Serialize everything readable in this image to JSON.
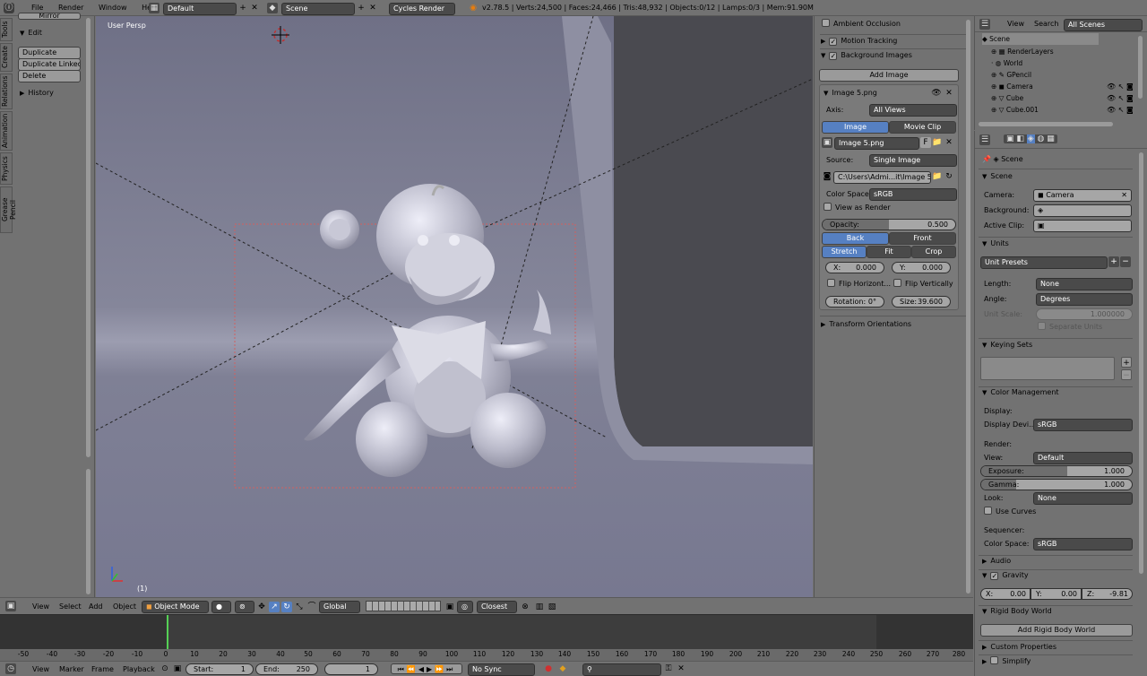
{
  "topbar": {
    "menus": [
      "File",
      "Render",
      "Window",
      "Help"
    ],
    "layout": "Default",
    "scene": "Scene",
    "engine": "Cycles Render",
    "stats": "v2.78.5 | Verts:24,500 | Faces:24,466 | Tris:48,932 | Objects:0/12 | Lamps:0/3 | Mem:91.90M"
  },
  "toolshelf": {
    "tabs": [
      "Tools",
      "Create",
      "Relations",
      "Animation",
      "Physics",
      "Grease Pencil"
    ],
    "top_cut": "Mirror",
    "edit_header": "Edit",
    "buttons": [
      "Duplicate",
      "Duplicate Linked",
      "Delete"
    ],
    "history_header": "History"
  },
  "viewport": {
    "view_label": "User Persp",
    "frame_label": "(1)"
  },
  "npanel": {
    "ambient_occlusion": "Ambient Occlusion",
    "motion_tracking": "Motion Tracking",
    "background_images": "Background Images",
    "add_image": "Add Image",
    "image_name": "Image 5.png",
    "axis_label": "Axis:",
    "axis_value": "All Views",
    "tab_image": "Image",
    "tab_movie": "Movie Clip",
    "image_field": "Image 5.png",
    "image_f": "F",
    "source_label": "Source:",
    "source_value": "Single Image",
    "path": "C:\\Users\\Admi...it\\Image 5.png",
    "colorspace_label": "Color Space:",
    "colorspace_value": "sRGB",
    "view_as_render": "View as Render",
    "opacity_label": "Opacity:",
    "opacity_value": "0.500",
    "opacity_fraction": 0.5,
    "back": "Back",
    "front": "Front",
    "stretch": "Stretch",
    "fit": "Fit",
    "crop": "Crop",
    "x_label": "X:",
    "x_value": "0.000",
    "y_label": "Y:",
    "y_value": "0.000",
    "flip_h": "Flip Horizont...",
    "flip_v": "Flip Vertically",
    "rotation_label": "Rotation:",
    "rotation_value": "0°",
    "size_label": "Size:",
    "size_value": "39.600",
    "transform_orientations": "Transform Orientations"
  },
  "outliner": {
    "view": "View",
    "search": "Search",
    "filter": "All Scenes",
    "rows": [
      "Scene",
      "RenderLayers",
      "World",
      "GPencil",
      "Camera",
      "Cube",
      "Cube.001"
    ]
  },
  "properties": {
    "context": "Scene",
    "scene_header": "Scene",
    "camera_label": "Camera:",
    "camera_value": "Camera",
    "background_label": "Background:",
    "active_clip_label": "Active Clip:",
    "units_header": "Units",
    "unit_presets": "Unit Presets",
    "length_label": "Length:",
    "length_value": "None",
    "angle_label": "Angle:",
    "angle_value": "Degrees",
    "unit_scale_label": "Unit Scale:",
    "unit_scale_value": "1.000000",
    "separate_units": "Separate Units",
    "keying_sets_header": "Keying Sets",
    "color_management_header": "Color Management",
    "display_label": "Display:",
    "display_device_label": "Display Devi...",
    "display_device_value": "sRGB",
    "render_label": "Render:",
    "view_label": "View:",
    "view_value": "Default",
    "exposure_label": "Exposure:",
    "exposure_value": "1.000",
    "gamma_label": "Gamma:",
    "gamma_value": "1.000",
    "look_label": "Look:",
    "look_value": "None",
    "use_curves": "Use Curves",
    "sequencer_label": "Sequencer:",
    "seq_colorspace_label": "Color Space:",
    "seq_colorspace_value": "sRGB",
    "audio_header": "Audio",
    "gravity_header": "Gravity",
    "gx_label": "X:",
    "gx_value": "0.00",
    "gy_label": "Y:",
    "gy_value": "0.00",
    "gz_label": "Z:",
    "gz_value": "-9.81",
    "rigid_body_header": "Rigid Body World",
    "add_rigid_body": "Add Rigid Body World",
    "custom_props_header": "Custom Properties",
    "simplify_header": "Simplify"
  },
  "view3d_header": {
    "menus": [
      "View",
      "Select",
      "Add",
      "Object"
    ],
    "mode": "Object Mode",
    "orientation": "Global",
    "snap": "Closest"
  },
  "timeline": {
    "ticks": [
      "-50",
      "-40",
      "-30",
      "-20",
      "-10",
      "0",
      "10",
      "20",
      "30",
      "40",
      "50",
      "60",
      "70",
      "80",
      "90",
      "100",
      "110",
      "120",
      "130",
      "140",
      "150",
      "160",
      "170",
      "180",
      "190",
      "200",
      "210",
      "220",
      "230",
      "240",
      "250",
      "260",
      "270",
      "280"
    ],
    "menus": [
      "View",
      "Marker",
      "Frame",
      "Playback"
    ],
    "start_label": "Start:",
    "start_value": "1",
    "end_label": "End:",
    "end_value": "250",
    "current": "1",
    "sync": "No Sync"
  }
}
